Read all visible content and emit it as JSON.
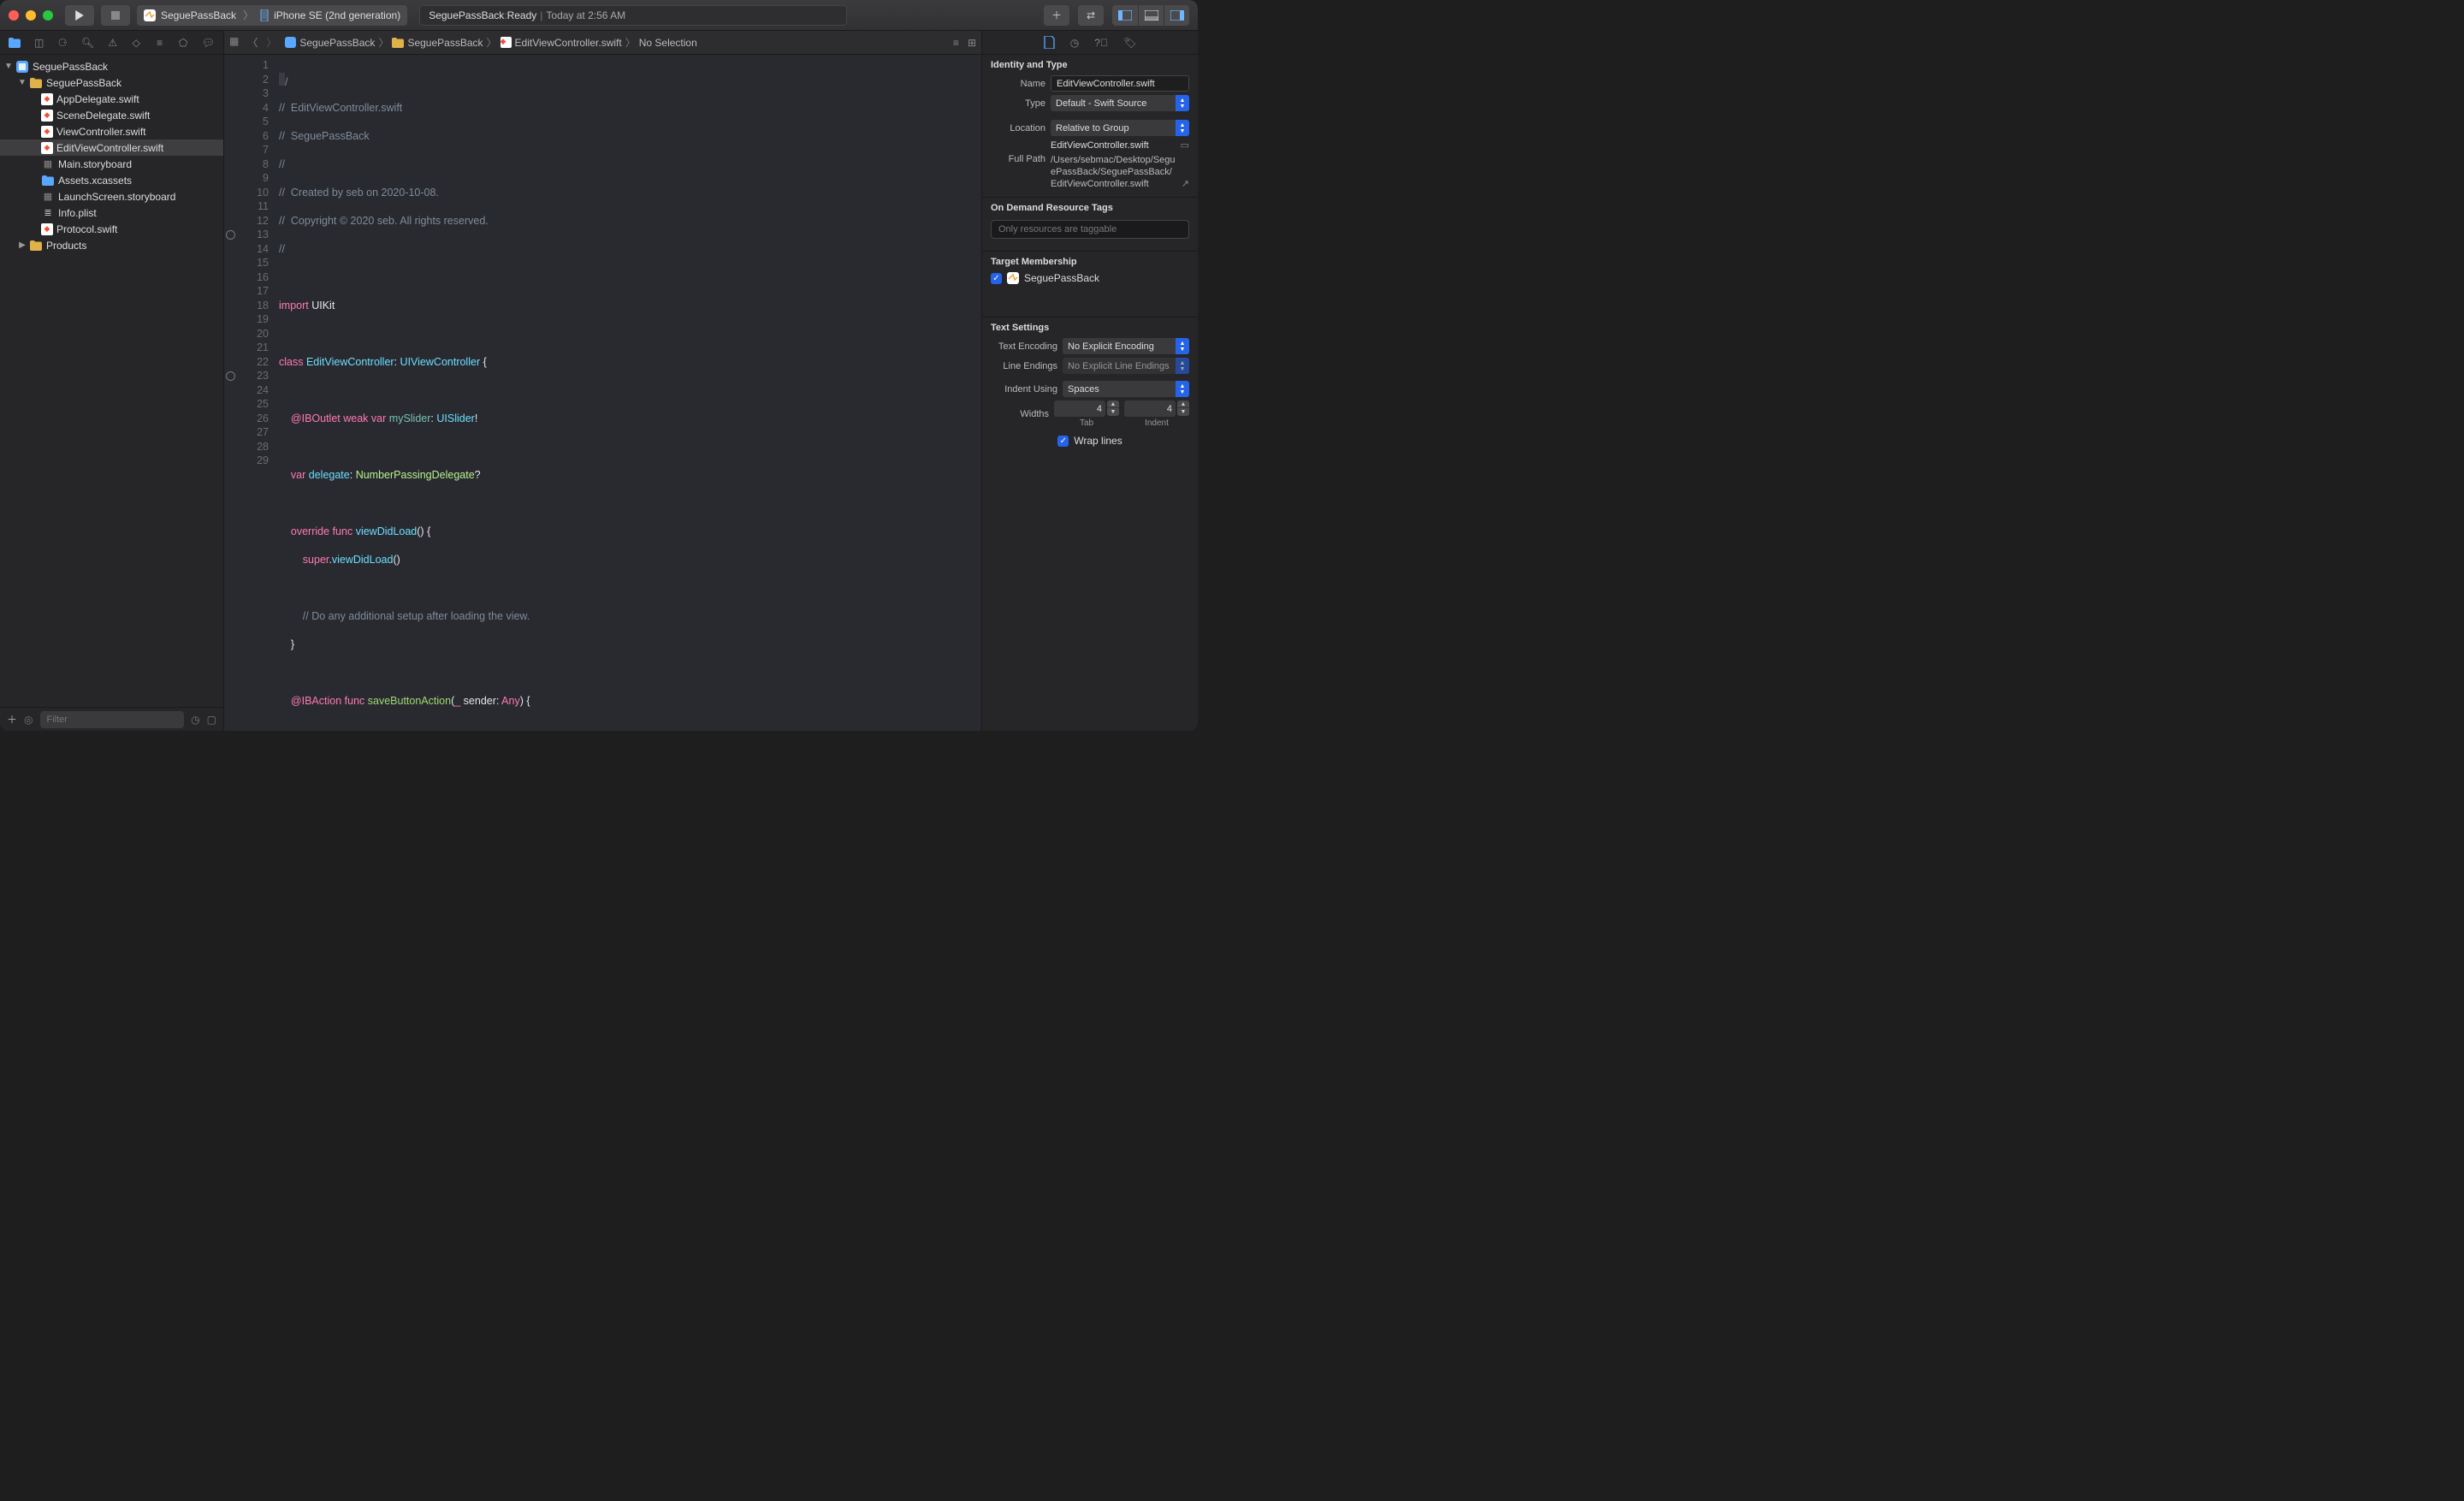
{
  "toolbar": {
    "scheme_app": "SeguePassBack",
    "scheme_device": "iPhone SE (2nd generation)"
  },
  "status": {
    "project": "SeguePassBack",
    "state": "Ready",
    "time": "Today at 2:56 AM"
  },
  "navigator": {
    "root": "SeguePassBack",
    "group": "SeguePassBack",
    "files": [
      "AppDelegate.swift",
      "SceneDelegate.swift",
      "ViewController.swift",
      "EditViewController.swift",
      "Main.storyboard",
      "Assets.xcassets",
      "LaunchScreen.storyboard",
      "Info.plist",
      "Protocol.swift"
    ],
    "products": "Products",
    "filter_placeholder": "Filter"
  },
  "jumpbar": {
    "c0": "SeguePassBack",
    "c1": "SeguePassBack",
    "c2": "EditViewController.swift",
    "c3": "No Selection"
  },
  "code": {
    "lines": [
      "//",
      "//  EditViewController.swift",
      "//  SeguePassBack",
      "//",
      "//  Created by seb on 2020-10-08.",
      "//  Copyright © 2020 seb. All rights reserved.",
      "//",
      "",
      "import UIKit",
      "",
      "class EditViewController: UIViewController {",
      "",
      "    @IBOutlet weak var mySlider: UISlider!",
      "    ",
      "    var delegate: NumberPassingDelegate?",
      "",
      "    override func viewDidLoad() {",
      "        super.viewDidLoad()",
      "",
      "        // Do any additional setup after loading the view.",
      "    }",
      "",
      "    @IBAction func saveButtonAction(_ sender: Any) {",
      "        ",
      "    }",
      "    ",
      "",
      "}",
      ""
    ]
  },
  "inspector": {
    "identity_title": "Identity and Type",
    "name_lbl": "Name",
    "name_val": "EditViewController.swift",
    "type_lbl": "Type",
    "type_val": "Default - Swift Source",
    "location_lbl": "Location",
    "location_val": "Relative to Group",
    "location_file": "EditViewController.swift",
    "fullpath_lbl": "Full Path",
    "fullpath_val": "/Users/sebmac/Desktop/SeguePassBack/SeguePassBack/EditViewController.swift",
    "tags_title": "On Demand Resource Tags",
    "tags_placeholder": "Only resources are taggable",
    "membership_title": "Target Membership",
    "membership_target": "SeguePassBack",
    "text_title": "Text Settings",
    "encoding_lbl": "Text Encoding",
    "encoding_val": "No Explicit Encoding",
    "lineend_lbl": "Line Endings",
    "lineend_val": "No Explicit Line Endings",
    "indent_lbl": "Indent Using",
    "indent_val": "Spaces",
    "widths_lbl": "Widths",
    "tab_val": "4",
    "tab_lbl": "Tab",
    "indent_width_val": "4",
    "indent_width_lbl": "Indent",
    "wrap_lbl": "Wrap lines"
  }
}
